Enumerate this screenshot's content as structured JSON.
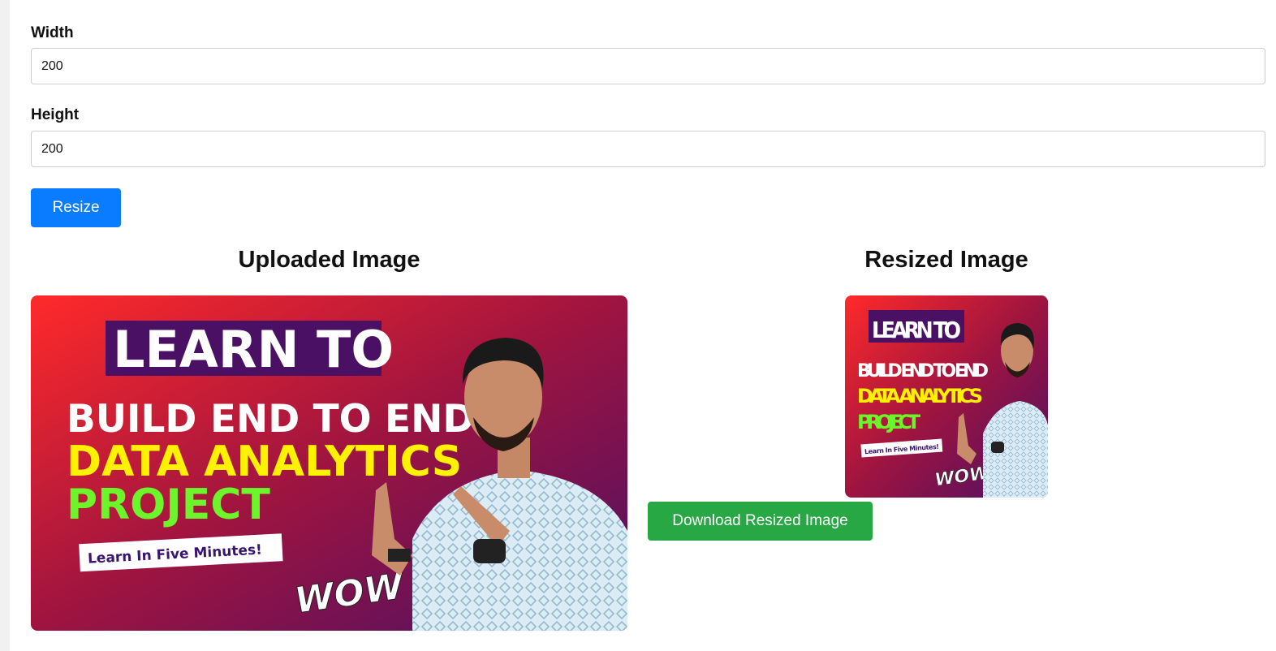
{
  "form": {
    "width_label": "Width",
    "width_value": "200",
    "height_label": "Height",
    "height_value": "200",
    "resize_label": "Resize"
  },
  "uploaded": {
    "heading": "Uploaded Image",
    "thumbnail": {
      "line1": "LEARN TO",
      "line2": "BUILD END TO END",
      "line3": "DATA ANALYTICS",
      "line4": "PROJECT",
      "tag": "Learn In Five Minutes!",
      "wow": "WOW"
    }
  },
  "resized": {
    "heading": "Resized Image",
    "download_label": "Download Resized Image"
  },
  "colors": {
    "primary": "#0a7cff",
    "success": "#28a745",
    "thumb_red": "#e8222b",
    "thumb_purple": "#5a1a6e",
    "thumb_yellow": "#fff200",
    "thumb_green": "#6cf52a"
  }
}
